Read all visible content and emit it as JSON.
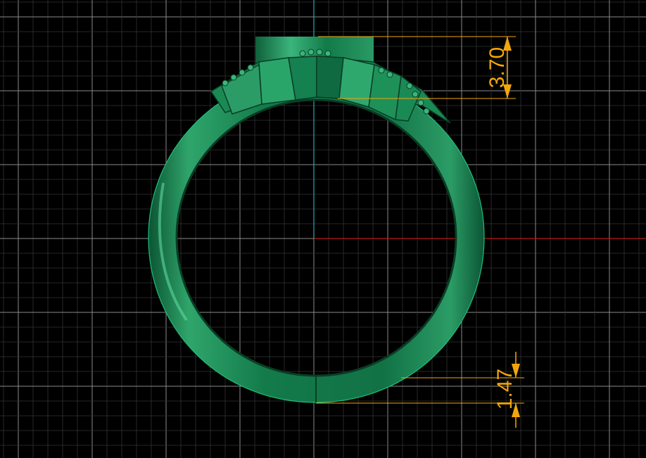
{
  "dimensions": {
    "top_height": "3.70",
    "bottom_thickness": "1.47"
  },
  "colors": {
    "background": "#000000",
    "grid_minor": "#333333",
    "grid_major": "#8a8a8a",
    "axis_x": "#b81b1b",
    "axis_y": "#2aa6b0",
    "ring_body": "#16824f",
    "ring_shadow": "#0a4a2c",
    "ring_highlight": "#46c48a",
    "dimension": "#f2a60c"
  }
}
